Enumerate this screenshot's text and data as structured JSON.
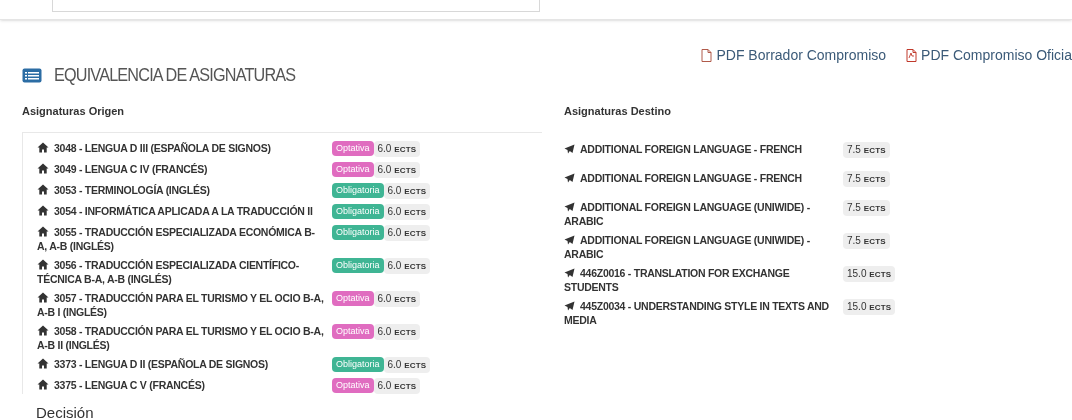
{
  "links": [
    {
      "label": "PDF Borrador Compromiso",
      "kind": "draft"
    },
    {
      "label": "PDF Compromiso Oficia",
      "kind": "official"
    }
  ],
  "section_title": "EQUIVALENCIA DE ASIGNATURAS",
  "origin": {
    "heading": "Asignaturas Origen",
    "items": [
      {
        "name": "3048 - LENGUA D III (ESPAÑOLA DE SIGNOS)",
        "type": "Optativa",
        "color": "#e06cc0",
        "credits": "6.0",
        "unit": "ECTS"
      },
      {
        "name": "3049 - LENGUA C IV (FRANCÉS)",
        "type": "Optativa",
        "color": "#e06cc0",
        "credits": "6.0",
        "unit": "ECTS"
      },
      {
        "name": "3053 - TERMINOLOGÍA (INGLÉS)",
        "type": "Obligatoria",
        "color": "#3fb594",
        "credits": "6.0",
        "unit": "ECTS"
      },
      {
        "name": "3054 - INFORMÁTICA APLICADA A LA TRADUCCIÓN II",
        "type": "Obligatoria",
        "color": "#3fb594",
        "credits": "6.0",
        "unit": "ECTS"
      },
      {
        "name": "3055 - TRADUCCIÓN ESPECIALIZADA ECONÓMICA B-A, A-B (INGLÉS)",
        "type": "Obligatoria",
        "color": "#3fb594",
        "credits": "6.0",
        "unit": "ECTS"
      },
      {
        "name": "3056 - TRADUCCIÓN ESPECIALIZADA CIENTÍFICO-TÉCNICA B-A, A-B (INGLÉS)",
        "type": "Obligatoria",
        "color": "#3fb594",
        "credits": "6.0",
        "unit": "ECTS"
      },
      {
        "name": "3057 - TRADUCCIÓN PARA EL TURISMO Y EL OCIO B-A, A-B I (INGLÉS)",
        "type": "Optativa",
        "color": "#e06cc0",
        "credits": "6.0",
        "unit": "ECTS"
      },
      {
        "name": "3058 - TRADUCCIÓN PARA EL TURISMO Y EL OCIO B-A, A-B II (INGLÉS)",
        "type": "Optativa",
        "color": "#e06cc0",
        "credits": "6.0",
        "unit": "ECTS"
      },
      {
        "name": "3373 - LENGUA D II (ESPAÑOLA DE SIGNOS)",
        "type": "Obligatoria",
        "color": "#3fb594",
        "credits": "6.0",
        "unit": "ECTS"
      },
      {
        "name": "3375 - LENGUA C V (FRANCÉS)",
        "type": "Optativa",
        "color": "#e06cc0",
        "credits": "6.0",
        "unit": "ECTS"
      }
    ]
  },
  "destination": {
    "heading": "Asignaturas Destino",
    "items": [
      {
        "name": "ADDITIONAL FOREIGN LANGUAGE - FRENCH",
        "credits": "7.5",
        "unit": "ECTS"
      },
      {
        "name": "ADDITIONAL FOREIGN LANGUAGE - FRENCH",
        "credits": "7.5",
        "unit": "ECTS"
      },
      {
        "name": "ADDITIONAL FOREIGN LANGUAGE (UNIWIDE) - ARABIC",
        "credits": "7.5",
        "unit": "ECTS"
      },
      {
        "name": "ADDITIONAL FOREIGN LANGUAGE (UNIWIDE) - ARABIC",
        "credits": "7.5",
        "unit": "ECTS"
      },
      {
        "name": "446Z0016 - TRANSLATION FOR EXCHANGE STUDENTS",
        "credits": "15.0",
        "unit": "ECTS"
      },
      {
        "name": "445Z0034 - UNDERSTANDING STYLE IN TEXTS AND MEDIA",
        "credits": "15.0",
        "unit": "ECTS"
      }
    ]
  },
  "decision_heading": "Decisión"
}
